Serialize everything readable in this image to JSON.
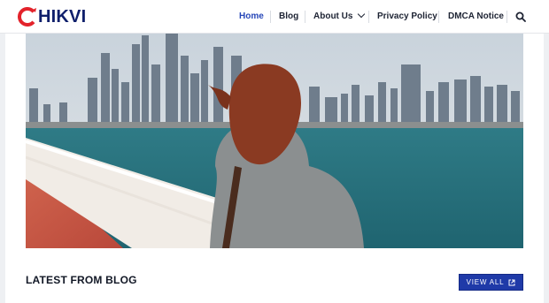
{
  "header": {
    "logo_text": "HIKVI",
    "nav": [
      {
        "label": "Home",
        "active": true
      },
      {
        "label": "Blog"
      },
      {
        "label": "About Us"
      },
      {
        "label": "Privacy Policy"
      },
      {
        "label": "DMCA Notice"
      }
    ],
    "search_icon": "search-icon",
    "dropdown_icon": "chevron-down-icon"
  },
  "hero": {
    "icon": "hero-image"
  },
  "latest": {
    "title": "LATEST FROM BLOG",
    "view_all_label": "VIEW ALL",
    "view_all_icon": "external-link-icon"
  },
  "colors": {
    "accent": "#2747b8",
    "logo_red": "#e3232b",
    "logo_navy": "#0f1f6b",
    "button_bg": "#1f3aa8"
  }
}
